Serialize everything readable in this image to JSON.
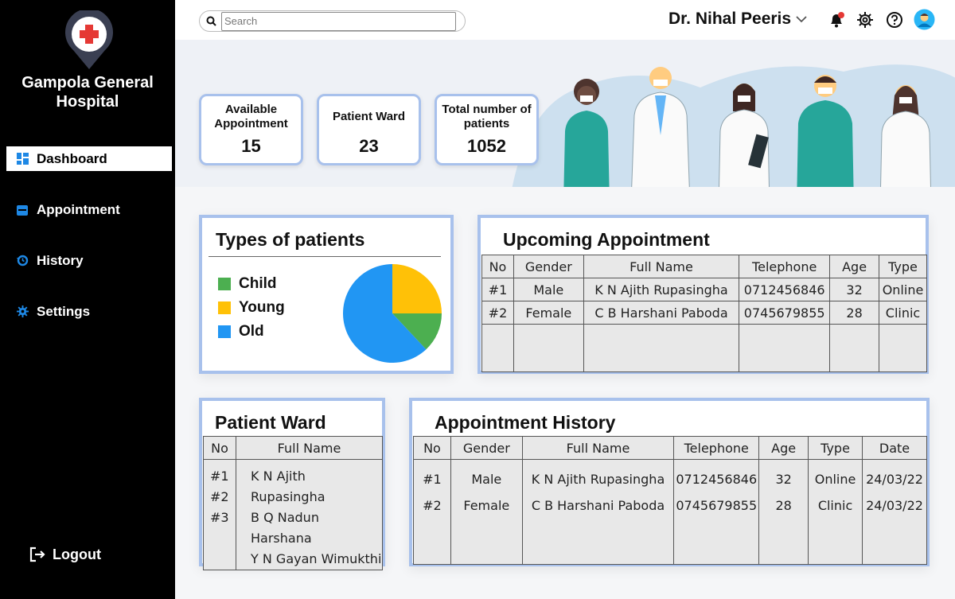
{
  "sidebar": {
    "hospital_name": "Gampola General Hospital",
    "nav": [
      {
        "label": "Dashboard",
        "icon": "dashboard-icon",
        "active": true
      },
      {
        "label": "Appointment",
        "icon": "calendar-icon",
        "active": false
      },
      {
        "label": "History",
        "icon": "history-icon",
        "active": false
      },
      {
        "label": "Settings",
        "icon": "gear-icon",
        "active": false
      }
    ],
    "logout_label": "Logout"
  },
  "topbar": {
    "search_placeholder": "Search",
    "user_name": "Dr. Nihal Peeris"
  },
  "stats": [
    {
      "label": "Available Appointment",
      "value": "15"
    },
    {
      "label": "Patient Ward",
      "value": "23"
    },
    {
      "label": "Total number of patients",
      "value": "1052"
    }
  ],
  "patient_types": {
    "title": "Types of patients",
    "chart_data": {
      "type": "pie",
      "labels": [
        "Child",
        "Young",
        "Old"
      ],
      "values": [
        13,
        25,
        62
      ],
      "colors": [
        "#4caf50",
        "#ffc107",
        "#2196f3"
      ]
    }
  },
  "upcoming": {
    "title": "Upcoming Appointment",
    "headers": [
      "No",
      "Gender",
      "Full Name",
      "Telephone",
      "Age",
      "Type"
    ],
    "rows": [
      [
        "#1",
        "Male",
        "K N Ajith Rupasingha",
        "0712456846",
        "32",
        "Online"
      ],
      [
        "#2",
        "Female",
        "C B Harshani Paboda",
        "0745679855",
        "28",
        "Clinic"
      ]
    ]
  },
  "ward": {
    "title": "Patient Ward",
    "headers": [
      "No",
      "Full Name"
    ],
    "rows": [
      [
        "#1",
        "K N Ajith Rupasingha"
      ],
      [
        "#2",
        "B Q Nadun Harshana"
      ],
      [
        "#3",
        "Y N Gayan Wimukthi"
      ]
    ]
  },
  "history": {
    "title": "Appointment History",
    "headers": [
      "No",
      "Gender",
      "Full Name",
      "Telephone",
      "Age",
      "Type",
      "Date"
    ],
    "rows": [
      [
        "#1",
        "Male",
        "K N Ajith Rupasingha",
        "0712456846",
        "32",
        "Online",
        "24/03/22"
      ],
      [
        "#2",
        "Female",
        "C B Harshani Paboda",
        "0745679855",
        "28",
        "Clinic",
        "24/03/22"
      ]
    ]
  },
  "colors": {
    "accent_border": "#a8c1ec",
    "icon_blue": "#1e88e5",
    "logo_red": "#e53935"
  }
}
